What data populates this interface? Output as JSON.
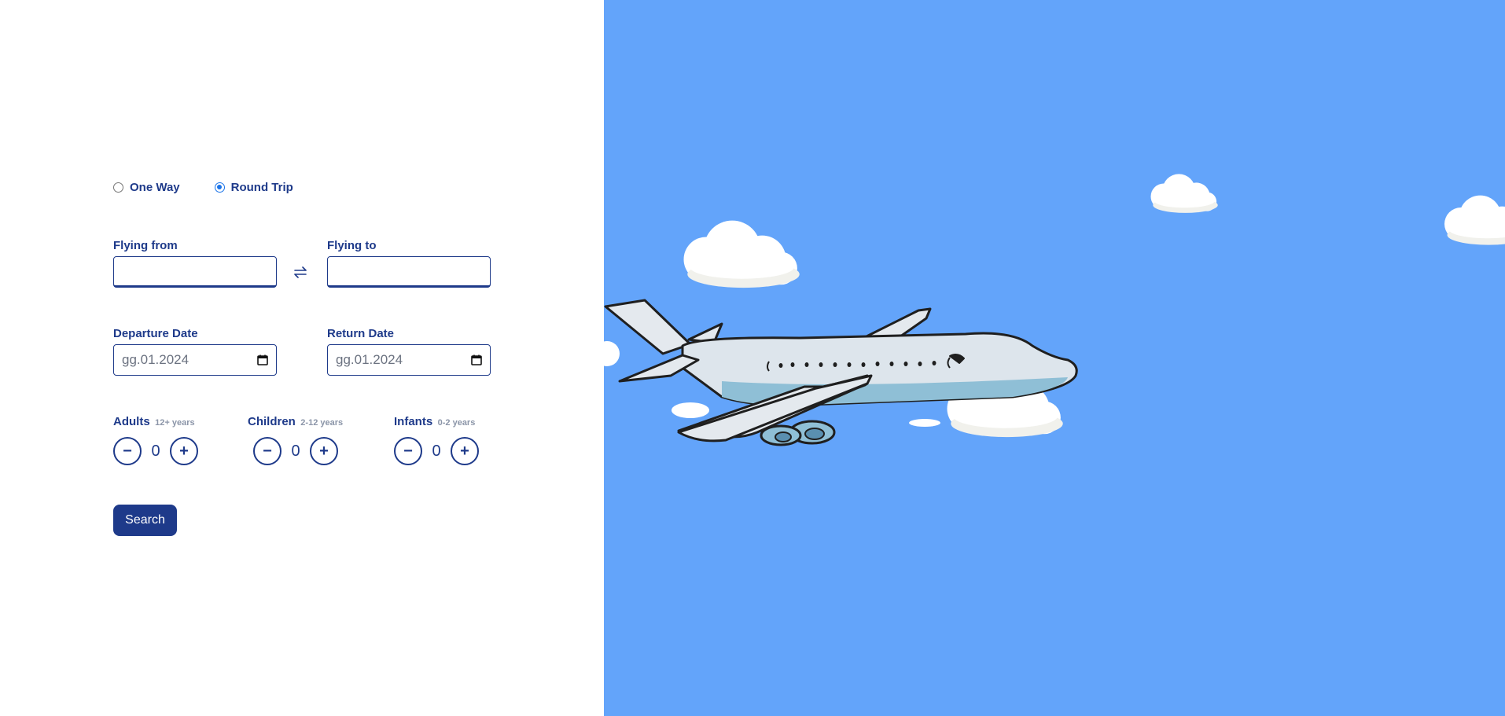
{
  "trip_type": {
    "options": [
      {
        "label": "One Way",
        "checked": false
      },
      {
        "label": "Round Trip",
        "checked": true
      }
    ]
  },
  "route": {
    "from_label": "Flying from",
    "from_value": "",
    "to_label": "Flying to",
    "to_value": "",
    "swap_icon": "swap-arrows-icon"
  },
  "dates": {
    "departure_label": "Departure Date",
    "departure_value": "gg.01.2024",
    "return_label": "Return Date",
    "return_value": "gg.01.2024",
    "calendar_icon": "calendar-icon"
  },
  "passengers": {
    "adults": {
      "label": "Adults",
      "sub": "12+ years",
      "value": "0"
    },
    "children": {
      "label": "Children",
      "sub": "2-12 years",
      "value": "0"
    },
    "infants": {
      "label": "Infants",
      "sub": "0-2 years",
      "value": "0"
    },
    "minus_symbol": "−",
    "plus_symbol": "+"
  },
  "search_label": "Search",
  "colors": {
    "primary": "#1e3a8a",
    "sky": "#63a4fa",
    "radio_accent": "#1a73e8"
  },
  "illustration": {
    "subject": "airplane-illustration",
    "clouds": "cloud-illustration"
  }
}
